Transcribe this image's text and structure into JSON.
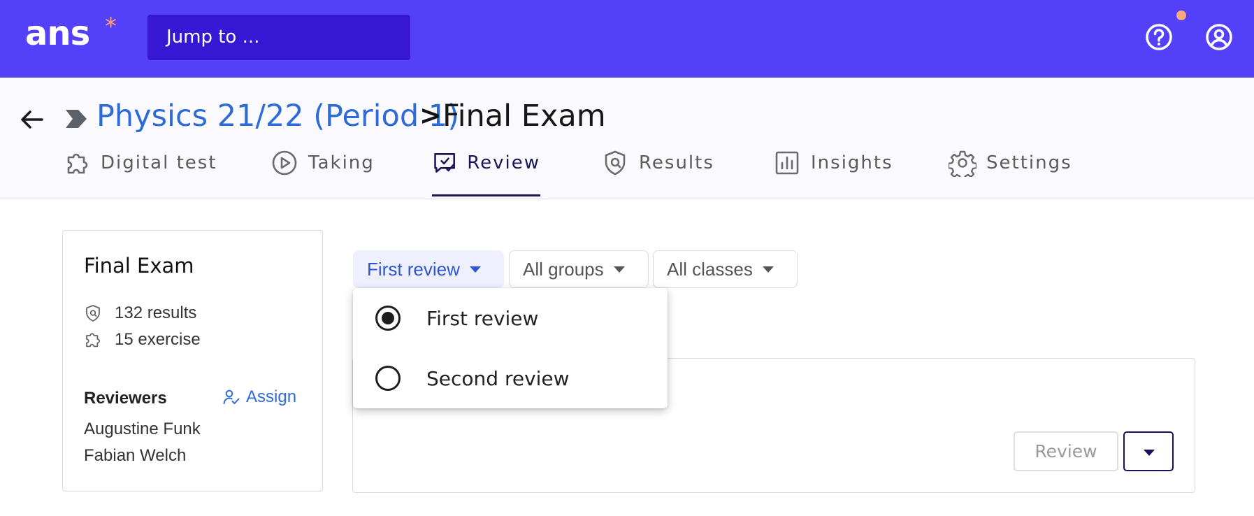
{
  "topbar": {
    "logo_text": "ans",
    "logo_star": "*",
    "jump_label": "Jump to ...",
    "help_icon": "help-circle-icon",
    "user_icon": "user-circle-icon"
  },
  "breadcrumb": {
    "parent": "Physics 21/22 (Period 1)",
    "separator": ">",
    "current": "Final Exam"
  },
  "tabs": [
    {
      "label": "Digital test",
      "icon": "puzzle-icon"
    },
    {
      "label": "Taking",
      "icon": "play-circle-icon"
    },
    {
      "label": "Review",
      "icon": "review-chat-icon",
      "active": true
    },
    {
      "label": "Results",
      "icon": "shield-icon"
    },
    {
      "label": "Insights",
      "icon": "bar-chart-icon"
    },
    {
      "label": "Settings",
      "icon": "gear-icon"
    }
  ],
  "info": {
    "title": "Final Exam",
    "results": "132 results",
    "exercises": "15 exercise",
    "reviewers_label": "Reviewers",
    "assign_label": "Assign",
    "reviewers": [
      "Augustine Funk",
      "Fabian Welch"
    ]
  },
  "filters": {
    "review": "First review",
    "groups": "All groups",
    "classes": "All classes"
  },
  "menu": {
    "options": [
      "First review",
      "Second review"
    ],
    "selected": "First review"
  },
  "actions": {
    "review_label": "Review"
  },
  "colors": {
    "topbar": "#5440f8",
    "jump_bg": "#3517d4",
    "link": "#2f6bd6",
    "active_tab": "#1a1557",
    "notification": "#f9a87f"
  }
}
